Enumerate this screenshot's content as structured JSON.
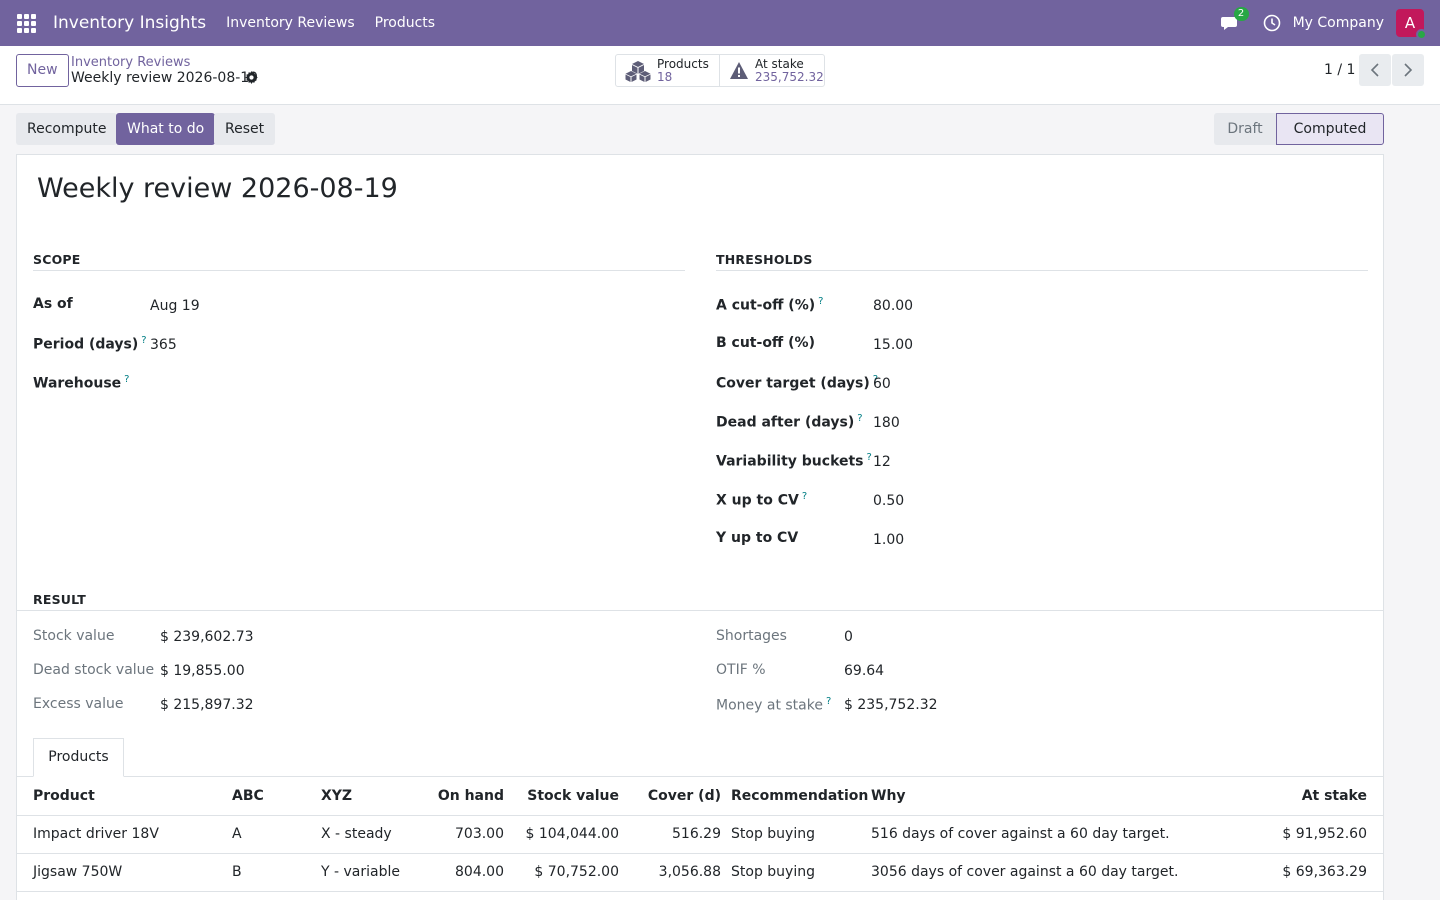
{
  "navbar": {
    "brand": "Inventory Insights",
    "menus": [
      "Inventory Reviews",
      "Products"
    ],
    "chat_count": "2",
    "company": "My Company",
    "avatar_initial": "A",
    "color": "#71639e"
  },
  "control": {
    "new_label": "New",
    "breadcrumb": "Inventory Reviews",
    "record_name": "Weekly review 2026-08-19",
    "smart_products_label": "Products",
    "smart_products_value": "18",
    "smart_stake_label": "At stake",
    "smart_stake_value": "235,752.32",
    "pager": "1 / 1"
  },
  "actions": {
    "recompute": "Recompute",
    "what_to_do": "What to do",
    "reset": "Reset"
  },
  "status": {
    "draft": "Draft",
    "computed": "Computed",
    "current": "Computed"
  },
  "form": {
    "title": "Weekly review 2026-08-19",
    "scope": {
      "heading": "SCOPE",
      "as_of_label": "As of",
      "as_of_value": "Aug 19",
      "period_label": "Period (days)",
      "period_value": "365",
      "warehouse_label": "Warehouse",
      "warehouse_value": ""
    },
    "thresholds": {
      "heading": "THRESHOLDS",
      "a_cutoff_label": "A cut-off (%)",
      "a_cutoff_value": "80.00",
      "b_cutoff_label": "B cut-off (%)",
      "b_cutoff_value": "15.00",
      "cover_label": "Cover target (days)",
      "cover_value": "60",
      "dead_label": "Dead after (days)",
      "dead_value": "180",
      "var_label": "Variability buckets",
      "var_value": "12",
      "x_label": "X up to CV",
      "x_value": "0.50",
      "y_label": "Y up to CV",
      "y_value": "1.00"
    },
    "result": {
      "heading": "RESULT",
      "stock_value_label": "Stock value",
      "stock_value": "$ 239,602.73",
      "dead_stock_label": "Dead stock value",
      "dead_stock_value": "$ 19,855.00",
      "excess_label": "Excess value",
      "excess_value": "$ 215,897.32",
      "shortages_label": "Shortages",
      "shortages_value": "0",
      "otif_label": "OTIF %",
      "otif_value": "69.64",
      "money_label": "Money at stake",
      "money_value": "$ 235,752.32"
    }
  },
  "products_tab": {
    "tab_label": "Products",
    "columns": [
      "Product",
      "ABC",
      "XYZ",
      "On hand",
      "Stock value",
      "Cover (d)",
      "Recommendation",
      "Why",
      "At stake"
    ],
    "rows": [
      [
        "Impact driver 18V",
        "A",
        "X - steady",
        "703.00",
        "$ 104,044.00",
        "516.29",
        "Stop buying",
        "516 days of cover against a 60 day target.",
        "$ 91,952.60"
      ],
      [
        "Jigsaw 750W",
        "B",
        "Y - variable",
        "804.00",
        "$ 70,752.00",
        "3,056.88",
        "Stop buying",
        "3056 days of cover against a 60 day target.",
        "$ 69,363.29"
      ]
    ]
  }
}
